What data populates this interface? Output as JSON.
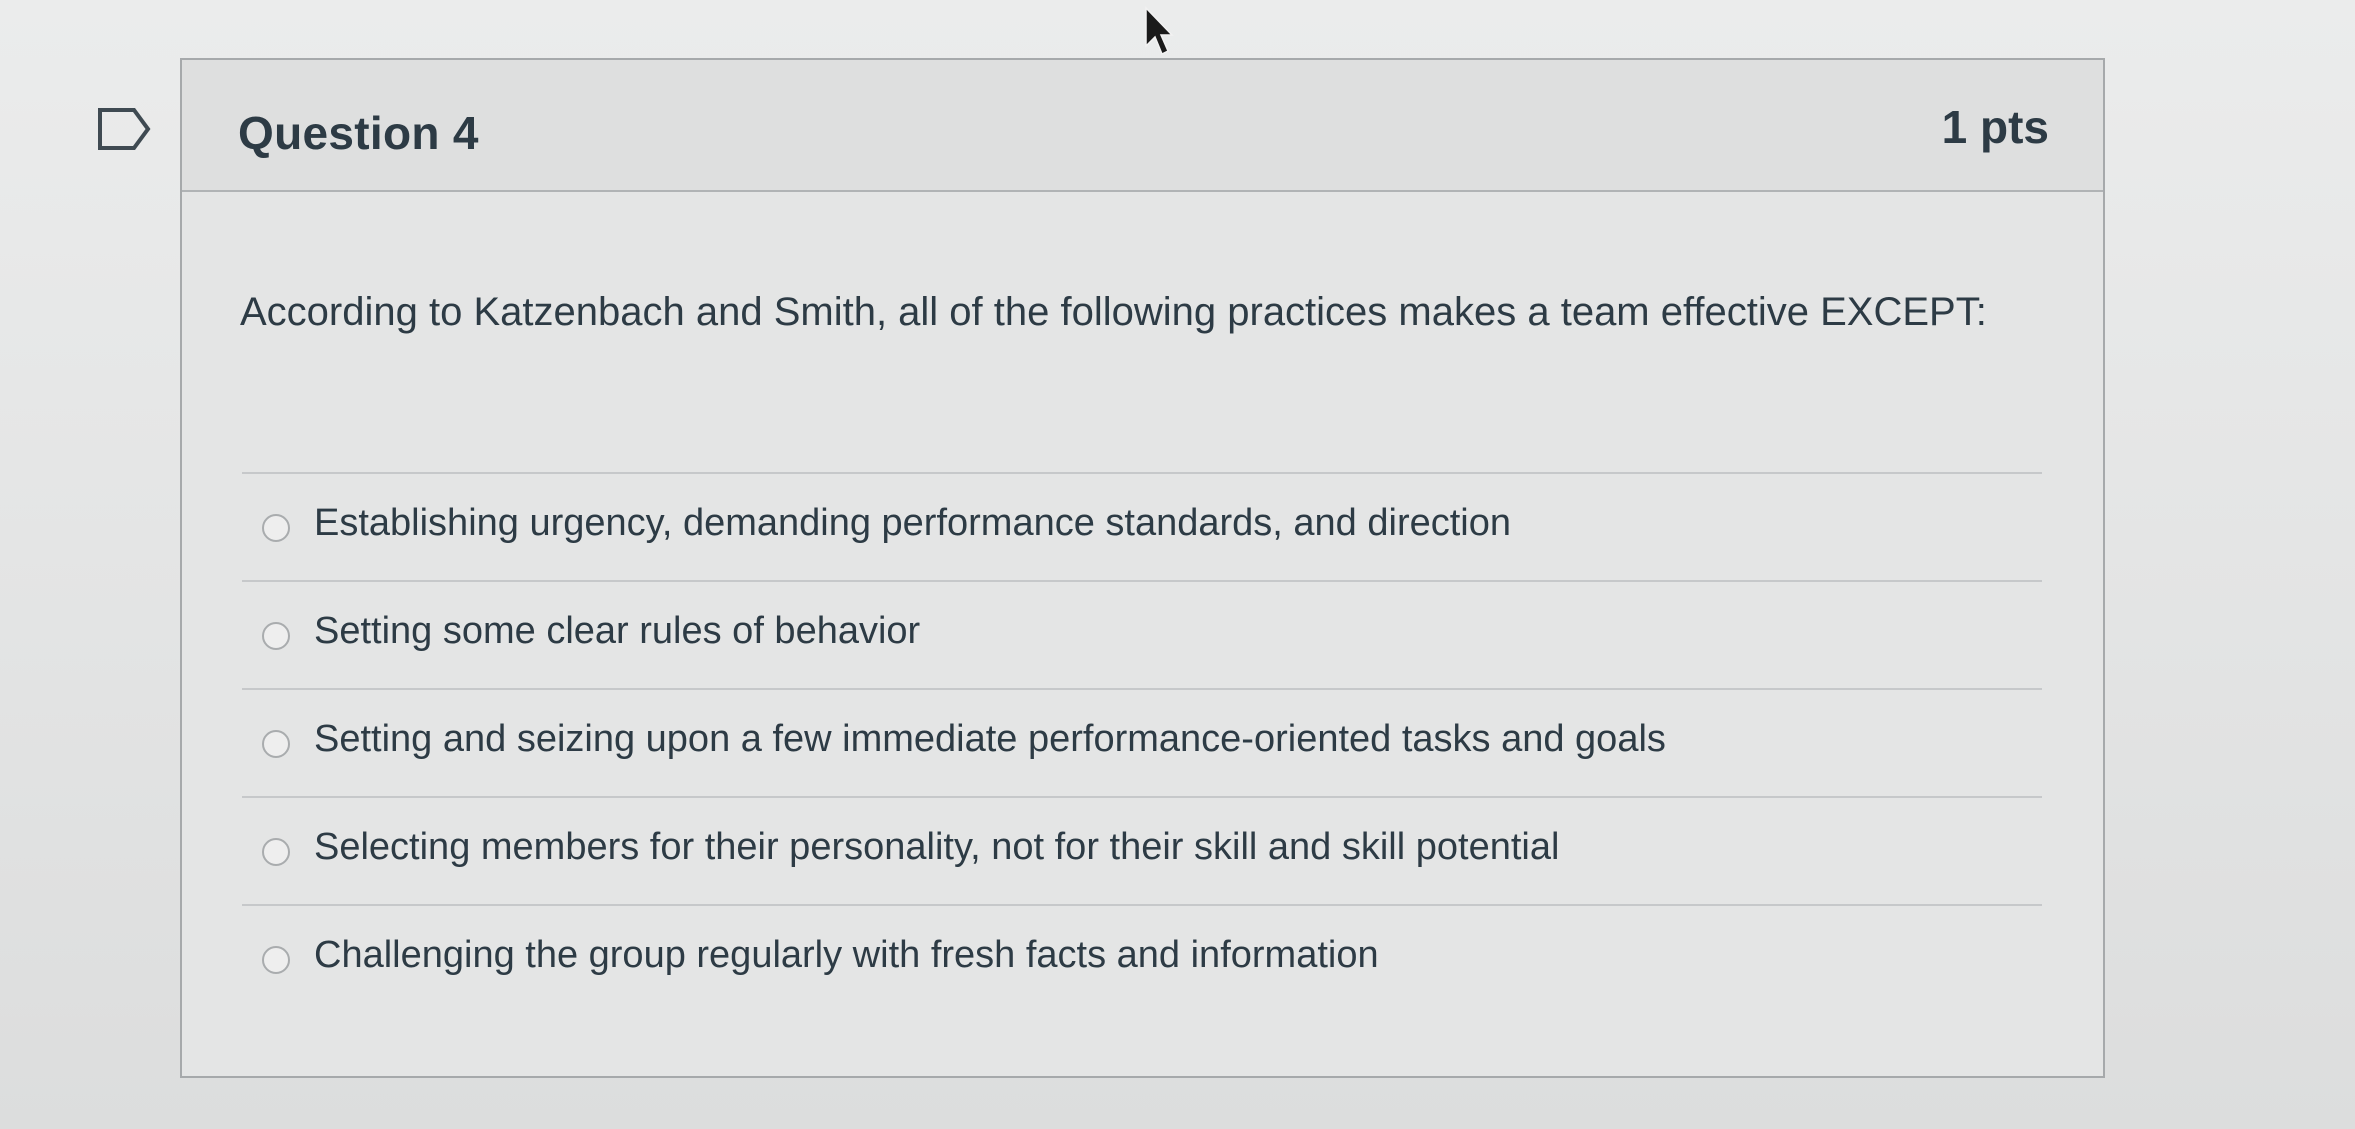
{
  "question": {
    "title": "Question 4",
    "points": "1 pts",
    "text": "According to Katzenbach and Smith, all of the following practices makes a team effective EXCEPT:",
    "answers": [
      {
        "label": "Establishing urgency, demanding performance standards, and direction"
      },
      {
        "label": "Setting some clear rules of behavior"
      },
      {
        "label": "Setting and seizing upon a few immediate performance-oriented tasks and goals"
      },
      {
        "label": "Selecting members for their personality, not for their skill and skill potential"
      },
      {
        "label": "Challenging the group regularly with fresh facts and information"
      }
    ]
  },
  "icons": {
    "flag": "flag-icon",
    "cursor": "mouse-cursor-icon",
    "radio": "radio-button"
  },
  "colors": {
    "text": "#2d3b45",
    "border": "#a6a9ab",
    "header_bg": "#dedfdf",
    "body_bg": "#e4e5e5"
  }
}
